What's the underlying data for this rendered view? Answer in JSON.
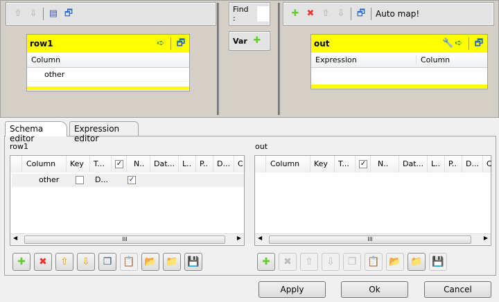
{
  "left_toolbar": {
    "icons": [
      "arrow-up-icon",
      "arrow-down-icon",
      "table-icon",
      "minimize-icon"
    ]
  },
  "find": {
    "label": "Find :",
    "value": ""
  },
  "var": {
    "label": "Var"
  },
  "right_toolbar": {
    "auto_map": "Auto map!"
  },
  "input_table": {
    "name": "row1",
    "column_header": "Column",
    "rows": [
      "other"
    ]
  },
  "output_table": {
    "name": "out",
    "headers": [
      "Expression",
      "Column"
    ]
  },
  "tabs": [
    {
      "label": "Schema editor",
      "active": true
    },
    {
      "label": "Expression editor",
      "active": false
    }
  ],
  "schema_left": {
    "title": "row1",
    "headers": [
      "Column",
      "Key",
      "T...",
      "N..",
      "Dat...",
      "L..",
      "P..",
      "D...",
      "C"
    ],
    "rows": [
      {
        "column": "other",
        "key": false,
        "type": "D...",
        "nullable": true
      }
    ]
  },
  "schema_right": {
    "title": "out",
    "headers": [
      "Column",
      "Key",
      "T...",
      "N..",
      "Dat...",
      "L..",
      "P..",
      "D...",
      "C."
    ],
    "rows": []
  },
  "scroll_grip": "III",
  "buttons": {
    "apply": "Apply",
    "ok": "Ok",
    "cancel": "Cancel"
  }
}
